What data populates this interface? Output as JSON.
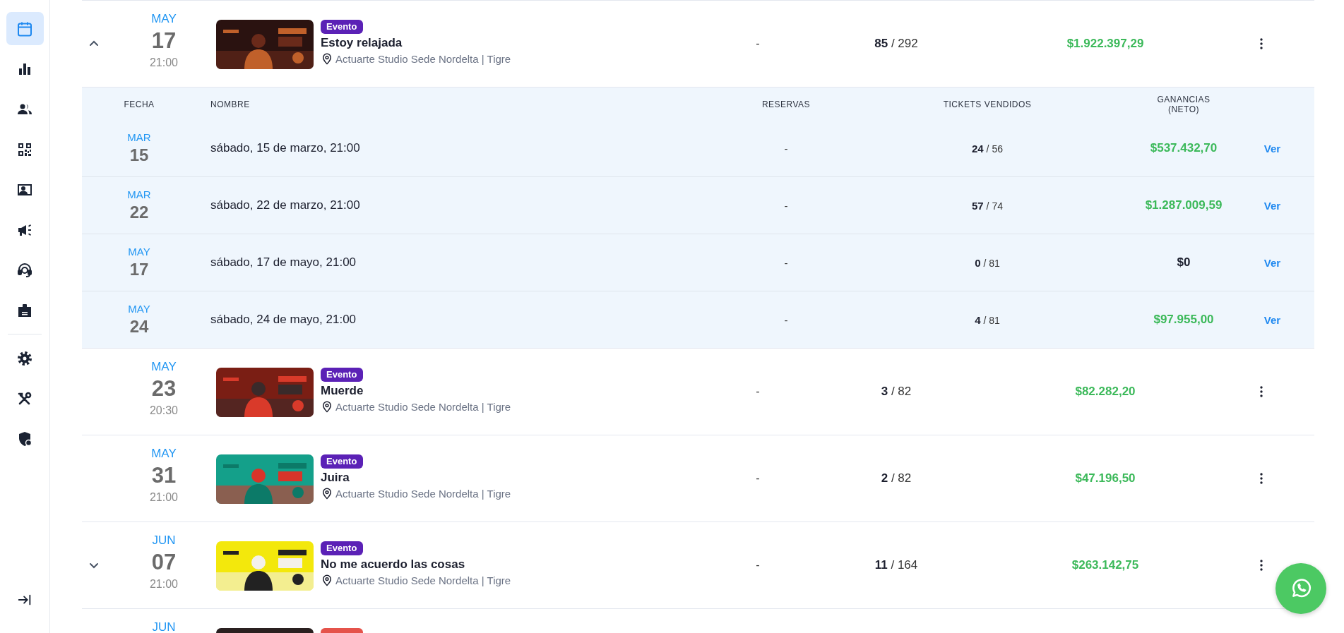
{
  "sidebar": {
    "items": [
      {
        "selected": true
      },
      {
        "selected": false
      },
      {
        "selected": false
      },
      {
        "selected": false
      },
      {
        "selected": false
      },
      {
        "selected": false
      },
      {
        "selected": false
      },
      {
        "selected": false
      },
      {
        "selected": false
      },
      {
        "selected": false
      },
      {
        "selected": false
      }
    ]
  },
  "events": [
    {
      "expanded": true,
      "month": "MAY",
      "day": "17",
      "time": "21:00",
      "badge": {
        "label": "Evento",
        "color": "#5b21b6"
      },
      "name": "Estoy relajada",
      "venue": "Actuarte Studio Sede Nordelta | Tigre",
      "reservas": "-",
      "tickets": "**85** / 292",
      "earnings": "$1.922.397,29",
      "positive": true,
      "sessions": {
        "columns": [
          "FECHA",
          "NOMBRE",
          "RESERVAS",
          "TICKETS VENDIDOS",
          "GANANCIAS (NETO)"
        ],
        "rows": [
          {
            "month": "MAR",
            "day": "15",
            "name": "sábado, 15 de marzo, 21:00",
            "reservas": "-",
            "tickets": "**24** / 56",
            "earnings": "$537.432,70",
            "positive": true,
            "action": "Ver"
          },
          {
            "month": "MAR",
            "day": "22",
            "name": "sábado, 22 de marzo, 21:00",
            "reservas": "-",
            "tickets": "**57** / 74",
            "earnings": "$1.287.009,59",
            "positive": true,
            "action": "Ver"
          },
          {
            "month": "MAY",
            "day": "17",
            "name": "sábado, 17 de mayo, 21:00",
            "reservas": "-",
            "tickets": "**0** / 81",
            "earnings": "$0",
            "positive": false,
            "action": "Ver"
          },
          {
            "month": "MAY",
            "day": "24",
            "name": "sábado, 24 de mayo, 21:00",
            "reservas": "-",
            "tickets": "**4** / 81",
            "earnings": "$97.955,00",
            "positive": true,
            "action": "Ver"
          }
        ]
      }
    },
    {
      "month": "MAY",
      "day": "23",
      "time": "20:30",
      "badge": {
        "label": "Evento",
        "color": "#5b21b6"
      },
      "name": "Muerde",
      "venue": "Actuarte Studio Sede Nordelta | Tigre",
      "reservas": "-",
      "tickets": "**3** / 82",
      "earnings": "$82.282,20",
      "positive": true
    },
    {
      "month": "MAY",
      "day": "31",
      "time": "21:00",
      "badge": {
        "label": "Evento",
        "color": "#5b21b6"
      },
      "name": "Juira",
      "venue": "Actuarte Studio Sede Nordelta | Tigre",
      "reservas": "-",
      "tickets": "**2** / 82",
      "earnings": "$47.196,50",
      "positive": true
    },
    {
      "expanded": false,
      "month": "JUN",
      "day": "07",
      "time": "21:00",
      "badge": {
        "label": "Evento",
        "color": "#5b21b6"
      },
      "name": "No me acuerdo las cosas",
      "venue": "Actuarte Studio Sede Nordelta | Tigre",
      "reservas": "-",
      "tickets": "**11** / 164",
      "earnings": "$263.142,75",
      "positive": true
    },
    {
      "month": "JUN",
      "badge": {
        "color": "#e5534b"
      }
    }
  ]
}
